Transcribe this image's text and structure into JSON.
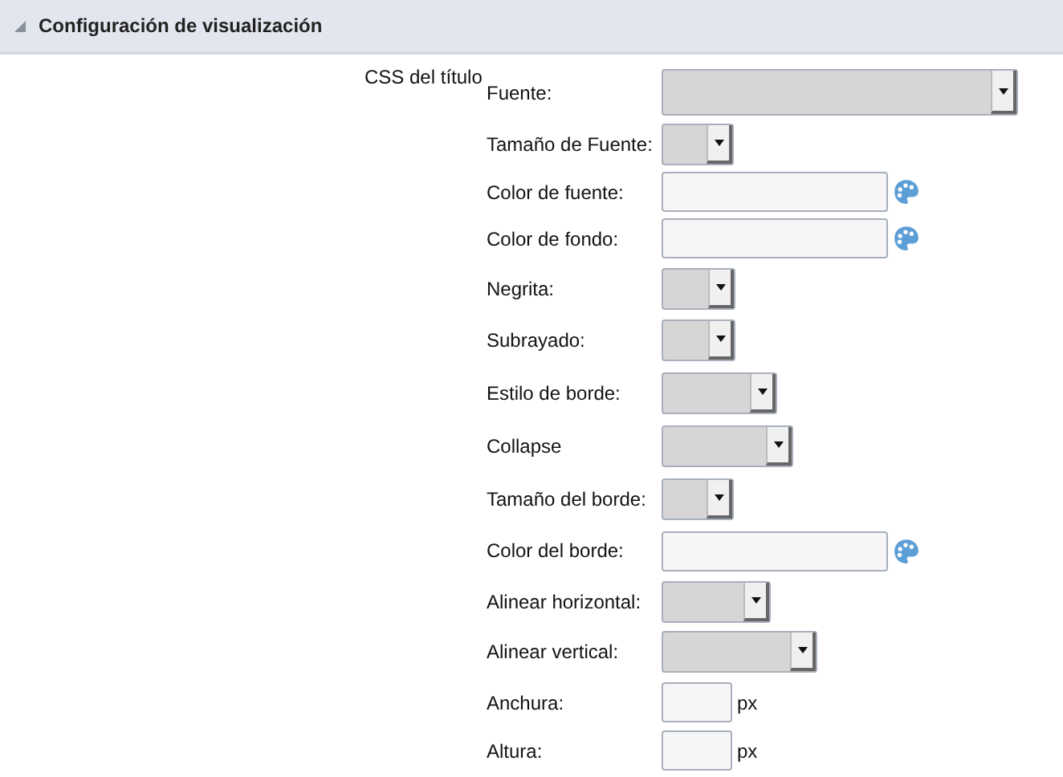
{
  "section": {
    "title": "Configuración de visualización",
    "expanded": true
  },
  "group_label": "CSS del título",
  "fields": [
    {
      "label": "Fuente:",
      "kind": "select"
    },
    {
      "label": "Tamaño de Fuente:",
      "kind": "select"
    },
    {
      "label": "Color de fuente:",
      "kind": "color"
    },
    {
      "label": "Color de fondo:",
      "kind": "color"
    },
    {
      "label": "Negrita:",
      "kind": "select"
    },
    {
      "label": "Subrayado:",
      "kind": "select"
    },
    {
      "label": "Estilo de borde:",
      "kind": "select"
    },
    {
      "label": "Collapse",
      "kind": "select"
    },
    {
      "label": "Tamaño del borde:",
      "kind": "select"
    },
    {
      "label": "Color del borde:",
      "kind": "color"
    },
    {
      "label": "Alinear horizontal:",
      "kind": "select"
    },
    {
      "label": "Alinear vertical:",
      "kind": "select"
    },
    {
      "label": "Anchura:",
      "kind": "size",
      "unit": "px"
    },
    {
      "label": "Altura:",
      "kind": "size",
      "unit": "px"
    }
  ]
}
